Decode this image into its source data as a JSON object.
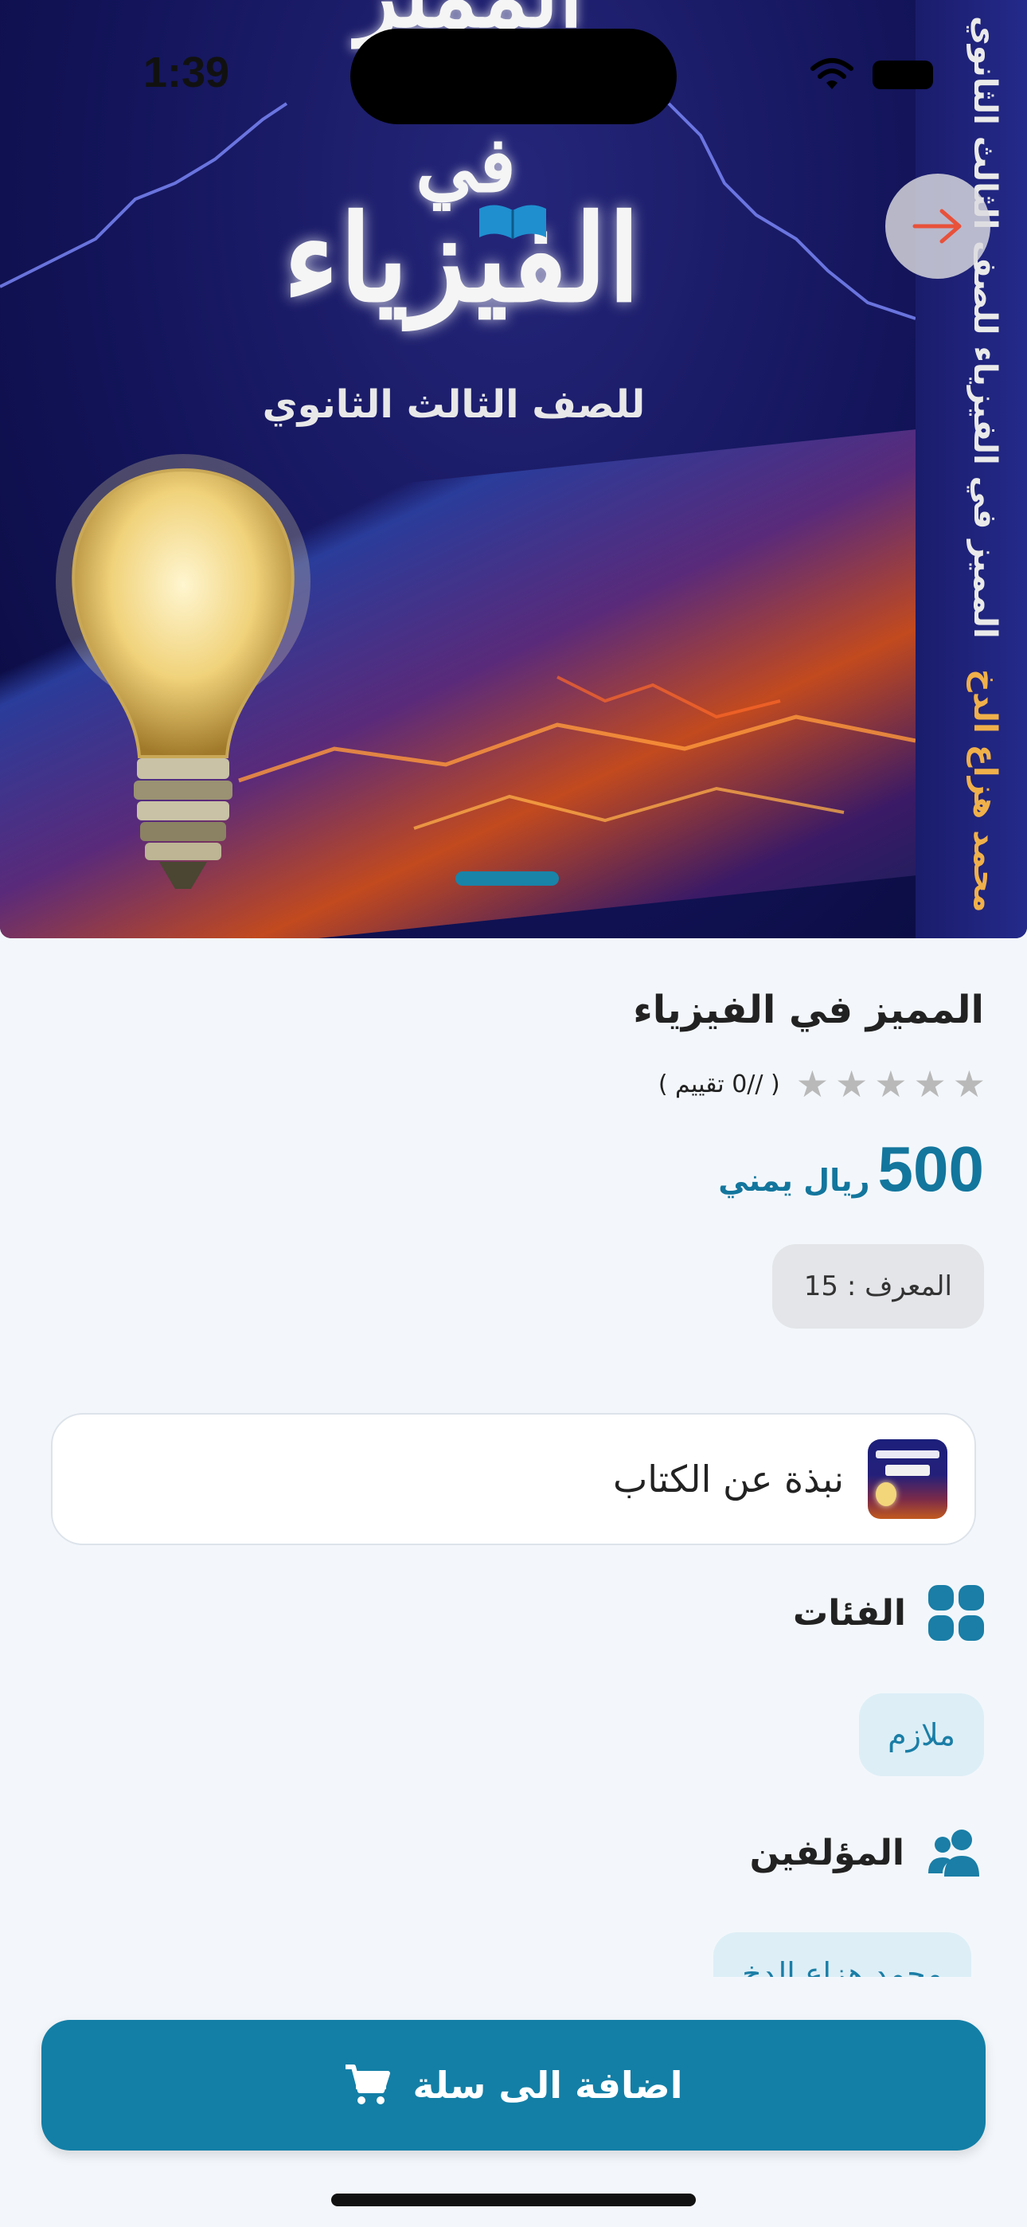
{
  "status_bar": {
    "time": "1:39"
  },
  "cover": {
    "top_text": "المميز",
    "fi": "في",
    "title": "الفيزياء",
    "subtitle": "للصف الثالث الثانوي",
    "spine_text": "المميز في الفيزياء للصف الثالث الثانوي",
    "spine_author": "محمد هزاع الدخ"
  },
  "book": {
    "title": "المميز في الفيزياء",
    "rating_text": "( //0 تقييم )",
    "stars": 5,
    "price_value": "500",
    "price_currency": "ريال يمني",
    "id_label": "المعرف : 15"
  },
  "about": {
    "label": "نبذة عن الكتاب"
  },
  "categories": {
    "title": "الفئات",
    "items": [
      "ملازم"
    ]
  },
  "authors": {
    "title": "المؤلفين",
    "items": [
      "محمد هزاع الدخ"
    ]
  },
  "cta": {
    "label": "اضافة الى سلة"
  },
  "colors": {
    "accent": "#137fa6",
    "chip_bg": "#ddeef6",
    "star": "#b9b9b9",
    "background": "#f3f7fb"
  },
  "icons": {
    "back": "arrow-right-icon",
    "categories": "grid-icon",
    "authors": "users-icon",
    "cart": "cart-icon"
  }
}
